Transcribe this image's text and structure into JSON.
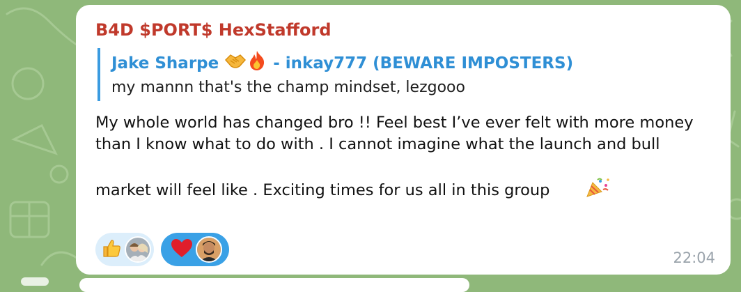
{
  "message": {
    "sender": "B4D $PORT$ HexStafford",
    "reply": {
      "author_name": "Jake Sharpe",
      "author_suffix": "- inkay777 (BEWARE IMPOSTERS)",
      "author_emojis": [
        "handshake-icon",
        "fire-icon"
      ],
      "text": "my mannn that's the champ mindset, lezgooo"
    },
    "text": "My whole world has changed bro !! Feel best I’ve ever felt with more money than I know what to do with . I cannot imagine what the launch and bull market will feel like . Exciting times for us all in this group",
    "trailing_emoji": "party-popper-icon",
    "reactions": [
      {
        "emoji": "thumbs-up-icon",
        "selected": false
      },
      {
        "emoji": "red-heart-icon",
        "selected": true
      }
    ],
    "time": "22:04"
  },
  "colors": {
    "sender": "#c0392b",
    "reply_author": "#2f8fd5",
    "reply_bar": "#3a9be0",
    "reaction_selected": "#3aa1e6",
    "reaction_unselected": "#dceefb",
    "time": "#9aa3ab",
    "wallpaper": "#8fb87a"
  }
}
